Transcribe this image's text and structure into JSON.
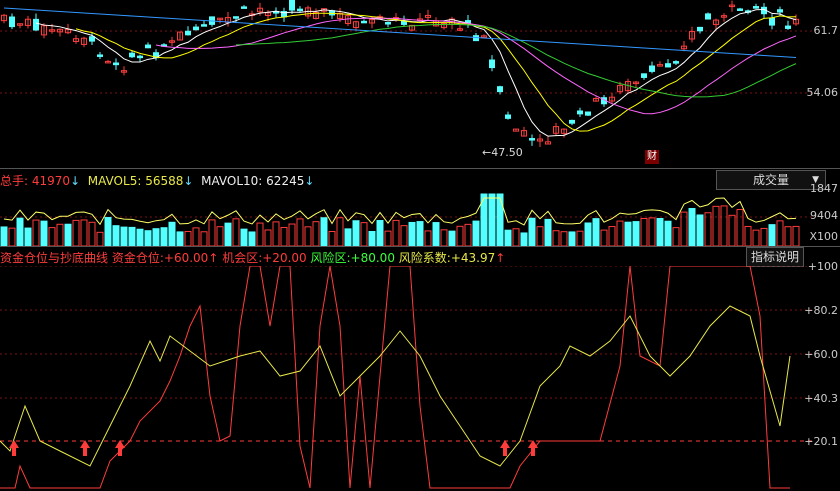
{
  "price_axis": {
    "upper": "61.7",
    "lower": "54.06"
  },
  "low_marker": "47.50",
  "financial_badge": "财",
  "volume_header": {
    "total_label": "总手:",
    "total_value": "41970",
    "mavol5_label": "MAVOL5:",
    "mavol5_value": "56588",
    "mavol10_label": "MAVOL10:",
    "mavol10_value": "62245",
    "selector": "成交量"
  },
  "volume_axis": {
    "top": "1847",
    "mid": "9404",
    "unit": "X100"
  },
  "indicator_header": {
    "title": "资金仓位与抄底曲线",
    "position_label": "资金仓位:",
    "position_value": "+60.00",
    "chance_label": "机会区:",
    "chance_value": "+20.00",
    "risk_label": "风险区:",
    "risk_value": "+80.00",
    "riskcoef_label": "风险系数:",
    "riskcoef_value": "+43.97",
    "help_button": "指标说明"
  },
  "indicator_axis": [
    "+100",
    "+80.2",
    "+60.0",
    "+40.3",
    "+20.1"
  ],
  "colors": {
    "up": "#ff3c3c",
    "down": "#54ffff",
    "ma5": "#ffffff",
    "ma10": "#ffff00",
    "ma20": "#ff66ff",
    "ma30": "#33cc33",
    "ma60": "#3399ff"
  }
}
